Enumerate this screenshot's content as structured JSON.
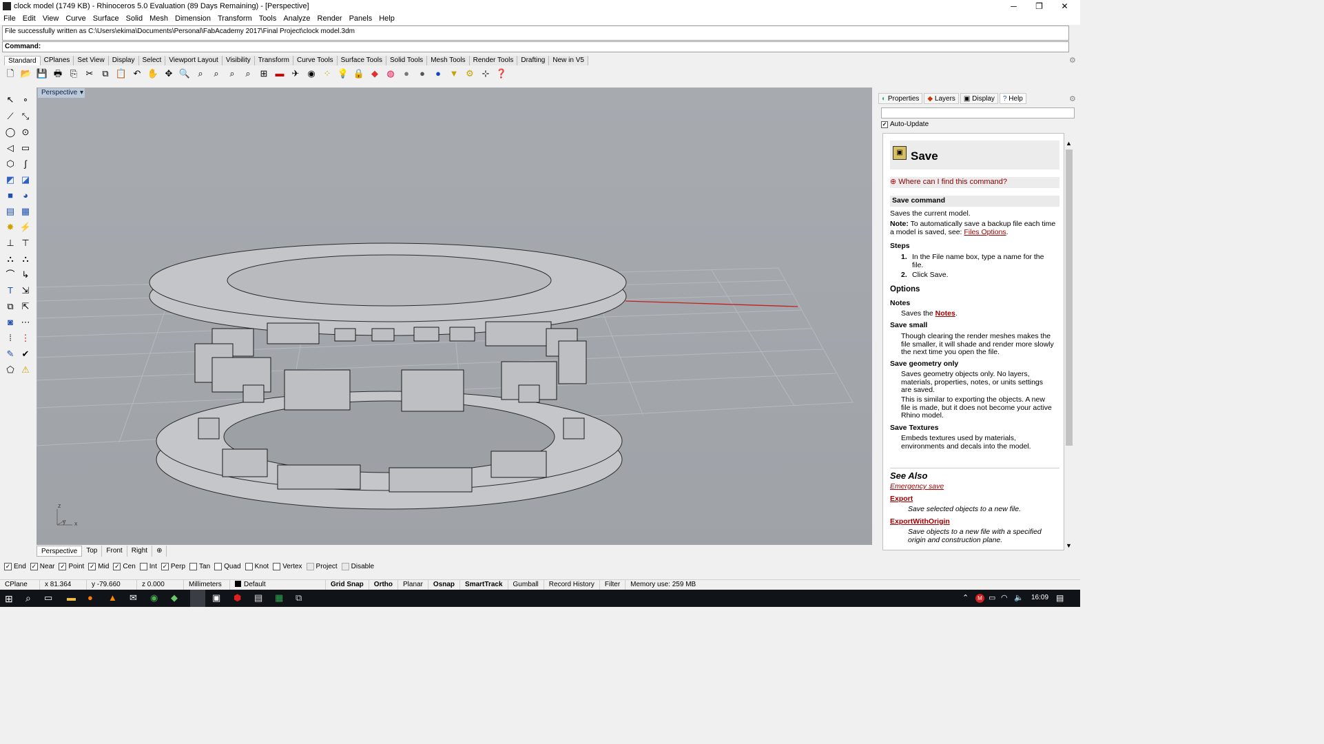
{
  "window": {
    "title": "clock model (1749 KB) - Rhinoceros 5.0 Evaluation (89 Days Remaining) - [Perspective]",
    "minimize": "─",
    "restore": "❐",
    "close": "✕"
  },
  "menu": [
    "File",
    "Edit",
    "View",
    "Curve",
    "Surface",
    "Solid",
    "Mesh",
    "Dimension",
    "Transform",
    "Tools",
    "Analyze",
    "Render",
    "Panels",
    "Help"
  ],
  "command": {
    "history": "File successfully written as C:\\Users\\ekima\\Documents\\Personal\\FabAcademy 2017\\Final Project\\clock model.3dm",
    "prompt": "Command:"
  },
  "toolbar_tabs": [
    "Standard",
    "CPlanes",
    "Set View",
    "Display",
    "Select",
    "Viewport Layout",
    "Visibility",
    "Transform",
    "Curve Tools",
    "Surface Tools",
    "Solid Tools",
    "Mesh Tools",
    "Render Tools",
    "Drafting",
    "New in V5"
  ],
  "toolbar_icons": [
    "new-icon",
    "open-icon",
    "save-icon",
    "print-icon",
    "import-icon",
    "cut-icon",
    "copy-icon",
    "paste-icon",
    "undo-icon",
    "pan-icon",
    "rotate-view-icon",
    "zoom-icon",
    "zoom-window-icon",
    "zoom-extents-icon",
    "zoom-selected-icon",
    "zoom-all-icon",
    "four-viewports-icon",
    "car-icon",
    "plane-icon",
    "camera-icon",
    "points-icon",
    "light-icon",
    "lock-icon",
    "material-icon",
    "color-wheel-icon",
    "shaded-sphere-icon",
    "rendered-sphere-icon",
    "render-sphere-icon",
    "filter-icon",
    "settings-icon",
    "grid-options-icon",
    "help-icon"
  ],
  "viewport": {
    "label": "Perspective",
    "axes": {
      "x": "x",
      "y": "y",
      "z": "z"
    }
  },
  "view_tabs": [
    "Perspective",
    "Top",
    "Front",
    "Right",
    "⊕"
  ],
  "osnaps": [
    {
      "label": "End",
      "checked": true
    },
    {
      "label": "Near",
      "checked": true
    },
    {
      "label": "Point",
      "checked": true
    },
    {
      "label": "Mid",
      "checked": true
    },
    {
      "label": "Cen",
      "checked": true
    },
    {
      "label": "Int",
      "checked": false
    },
    {
      "label": "Perp",
      "checked": true
    },
    {
      "label": "Tan",
      "checked": false
    },
    {
      "label": "Quad",
      "checked": false
    },
    {
      "label": "Knot",
      "checked": false
    },
    {
      "label": "Vertex",
      "checked": false
    },
    {
      "label": "Project",
      "checked": false
    },
    {
      "label": "Disable",
      "checked": false
    }
  ],
  "status": {
    "cplane": "CPlane",
    "x": "x 81.364",
    "y": "y -79.660",
    "z": "z 0.000",
    "units": "Millimeters",
    "layer": "Default",
    "modes": [
      "Grid Snap",
      "Ortho",
      "Planar",
      "Osnap",
      "SmartTrack",
      "Gumball",
      "Record History",
      "Filter"
    ],
    "memory": "Memory use: 259 MB"
  },
  "panel": {
    "tabs": [
      "Properties",
      "Layers",
      "Display",
      "Help"
    ],
    "auto_update": "Auto-Update",
    "title": "Save",
    "where": "Where can I find this command?",
    "section": "Save command",
    "intro": "Saves the current model.",
    "note_label": "Note:",
    "note_text": " To automatically save a backup file each time a model is saved, see: ",
    "note_link": "Files Options",
    "steps_h": "Steps",
    "step1": "In the File name box, type a name for the file.",
    "step2": "Click Save.",
    "options_h": "Options",
    "notes_h": "Notes",
    "notes_text": "Saves the ",
    "notes_link": "Notes",
    "small_h": "Save small",
    "small_text": "Though clearing the render meshes makes the file smaller, it will shade and render more slowly the next time you open the file.",
    "geo_h": "Save geometry only",
    "geo_text1": "Saves geometry objects only. No layers, materials, properties, notes, or units settings are saved.",
    "geo_text2": "This is similar to exporting the objects. A new file is made, but it does not become your active Rhino model.",
    "tex_h": "Save Textures",
    "tex_text": "Embeds textures used by materials, environments and decals into the model.",
    "see_also": "See Also",
    "links": [
      {
        "name": "Emergency save",
        "desc": ""
      },
      {
        "name": "Export",
        "desc": "Save selected objects to a new file."
      },
      {
        "name": "ExportWithOrigin",
        "desc": "Save objects to a new file with a specified origin and construction plane."
      }
    ]
  },
  "taskbar": {
    "time": "16:09"
  }
}
